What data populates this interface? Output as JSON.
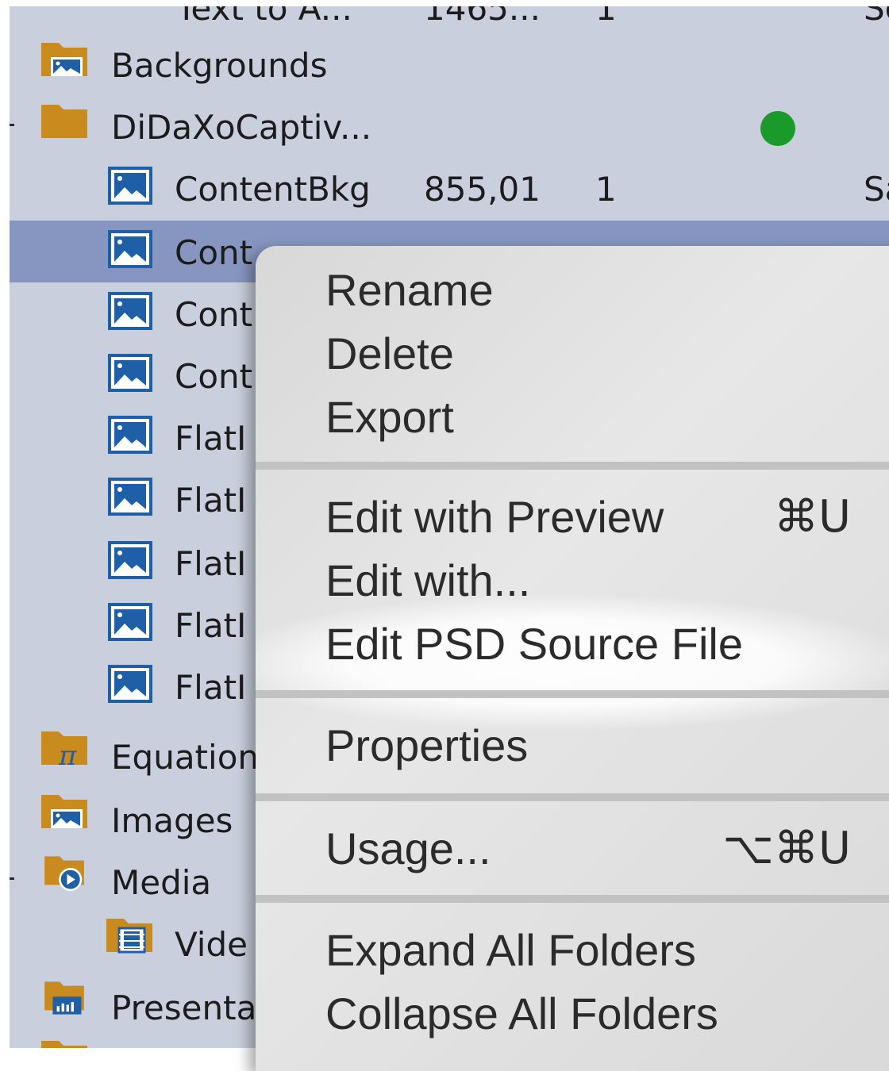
{
  "library": {
    "top_partial_row": {
      "name": "Text to A...",
      "size": "1465...",
      "use": "1",
      "status": "Sc"
    },
    "rows": [
      {
        "label": "Backgrounds",
        "type": "folder-images"
      },
      {
        "label": "DiDaXoCaptiv...",
        "type": "folder",
        "status_dot_color": "#1a9a2a"
      },
      {
        "label": "ContentBkg",
        "size": "855,01",
        "use": "1",
        "status": "Sa",
        "type": "image"
      },
      {
        "label": "Cont",
        "type": "image",
        "selected": true
      },
      {
        "label": "Cont",
        "type": "image"
      },
      {
        "label": "Cont",
        "type": "image"
      },
      {
        "label": "FlatI",
        "type": "image"
      },
      {
        "label": "FlatI",
        "type": "image"
      },
      {
        "label": "FlatI",
        "type": "image"
      },
      {
        "label": "FlatI",
        "type": "image"
      },
      {
        "label": "FlatI",
        "type": "image"
      },
      {
        "label": "Equation",
        "type": "folder-equation"
      },
      {
        "label": "Images",
        "type": "folder-images"
      },
      {
        "label": "Media",
        "type": "folder-media"
      },
      {
        "label": "Vide",
        "type": "folder-video"
      },
      {
        "label": "Presenta",
        "type": "folder-presentation"
      }
    ]
  },
  "context_menu": {
    "items": [
      {
        "label": "Rename"
      },
      {
        "label": "Delete"
      },
      {
        "label": "Export"
      },
      {
        "label": "Edit with Preview",
        "shortcut": "⌘U"
      },
      {
        "label": "Edit with..."
      },
      {
        "label": "Edit PSD Source File",
        "highlighted": true
      },
      {
        "label": "Properties"
      },
      {
        "label": "Usage...",
        "shortcut": "⌥⌘U"
      },
      {
        "label": "Expand All Folders"
      },
      {
        "label": "Collapse All Folders"
      }
    ]
  },
  "colors": {
    "panel_bg": "#c9cfdc",
    "selection_bg": "#8796c0",
    "folder": "#c98a1e",
    "icon_blue": "#1f5fa8",
    "status_dot": "#1a9a2a",
    "menu_bg": "#dcdcdc"
  }
}
